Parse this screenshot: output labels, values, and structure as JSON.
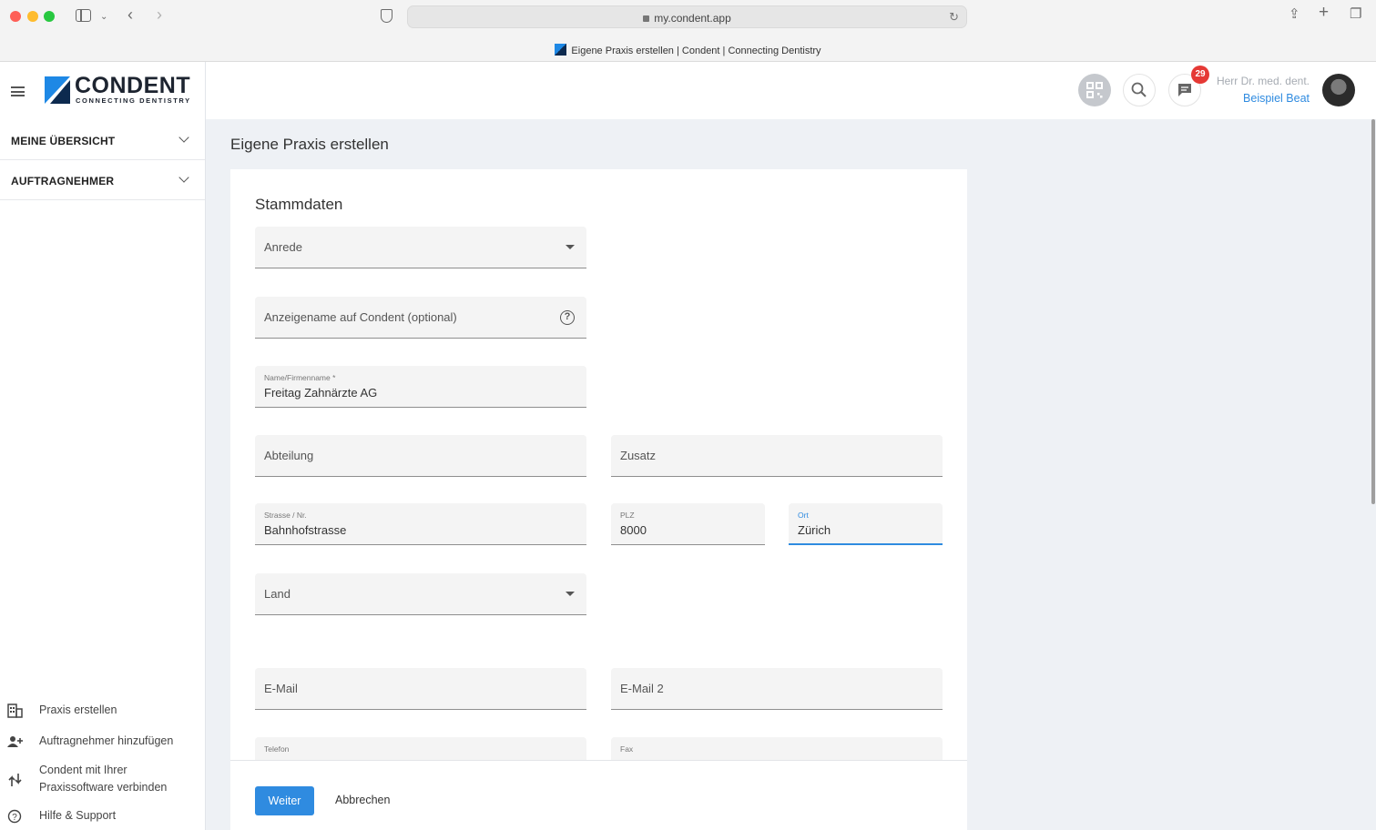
{
  "browser": {
    "url": "my.condent.app",
    "tab_title": "Eigene Praxis erstellen | Condent | Connecting Dentistry"
  },
  "header": {
    "logo_text": "CONDENT",
    "logo_sub": "CONNECTING DENTISTRY",
    "notification_count": "29",
    "user_title": "Herr Dr. med. dent.",
    "user_name": "Beispiel Beat"
  },
  "sidebar": {
    "sections": [
      {
        "label": "MEINE ÜBERSICHT"
      },
      {
        "label": "AUFTRAGNEHMER"
      }
    ],
    "links": [
      {
        "label": "Praxis erstellen",
        "icon": "building-icon"
      },
      {
        "label": "Auftragnehmer hinzufügen",
        "icon": "add-user-icon"
      },
      {
        "label": "Condent mit Ihrer Praxissoftware verbinden",
        "icon": "connect-icon"
      },
      {
        "label": "Hilfe & Support",
        "icon": "help-icon"
      }
    ]
  },
  "main": {
    "page_title": "Eigene Praxis erstellen",
    "card_title": "Stammdaten",
    "fields": {
      "anrede": {
        "placeholder": "Anrede"
      },
      "anzeigename": {
        "placeholder": "Anzeigename auf Condent (optional)"
      },
      "name": {
        "label": "Name/Firmenname *",
        "value": "Freitag Zahnärzte AG"
      },
      "abteilung": {
        "placeholder": "Abteilung"
      },
      "zusatz": {
        "placeholder": "Zusatz"
      },
      "strasse": {
        "label": "Strasse / Nr.",
        "value": "Bahnhofstrasse"
      },
      "plz": {
        "label": "PLZ",
        "value": "8000"
      },
      "ort": {
        "label": "Ort",
        "value": "Zürich"
      },
      "land": {
        "placeholder": "Land"
      },
      "email": {
        "placeholder": "E-Mail"
      },
      "email2": {
        "placeholder": "E-Mail 2"
      },
      "telefon": {
        "label": "Telefon"
      },
      "fax": {
        "label": "Fax"
      }
    },
    "buttons": {
      "next": "Weiter",
      "cancel": "Abbrechen"
    }
  },
  "colors": {
    "accent": "#2f8be0",
    "badge": "#e53935"
  }
}
